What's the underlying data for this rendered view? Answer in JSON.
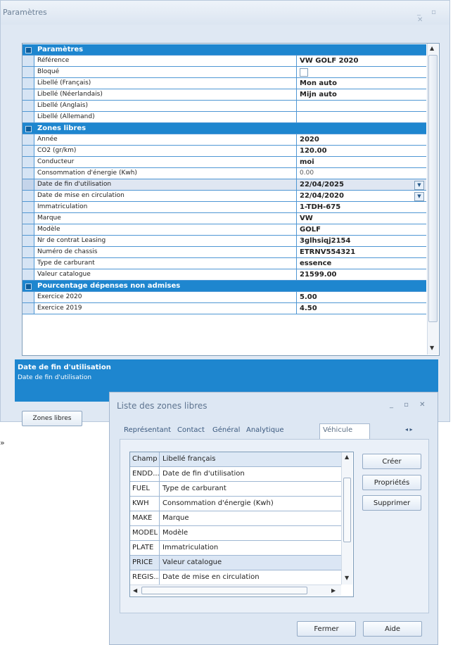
{
  "main_window": {
    "title": "Paramètres",
    "window_buttons": "_ ▫ ✕"
  },
  "grid": {
    "rows": [
      {
        "type": "header",
        "label": "Paramètres"
      },
      {
        "type": "row",
        "label": "Référence",
        "value": "VW GOLF 2020"
      },
      {
        "type": "checkbox",
        "label": "Bloqué",
        "value": ""
      },
      {
        "type": "row",
        "label": "Libellé (Français)",
        "value": "Mon auto"
      },
      {
        "type": "row",
        "label": "Libellé (Néerlandais)",
        "value": "Mijn auto"
      },
      {
        "type": "row",
        "label": "Libellé (Anglais)",
        "value": ""
      },
      {
        "type": "row",
        "label": "Libellé (Allemand)",
        "value": ""
      },
      {
        "type": "header",
        "label": "Zones libres"
      },
      {
        "type": "row",
        "label": "Année",
        "value": "2020"
      },
      {
        "type": "row",
        "label": "CO2 (gr/km)",
        "value": "120.00"
      },
      {
        "type": "row",
        "label": "Conducteur",
        "value": "moi"
      },
      {
        "type": "light",
        "label": "Consommation d'énergie (Kwh)",
        "value": "0.00"
      },
      {
        "type": "date",
        "label": "Date de fin d'utilisation",
        "value": "22/04/2025",
        "selected": true
      },
      {
        "type": "date",
        "label": "Date de mise en circulation",
        "value": "22/04/2020"
      },
      {
        "type": "row",
        "label": "Immatriculation",
        "value": "1-TDH-675"
      },
      {
        "type": "row",
        "label": "Marque",
        "value": "VW"
      },
      {
        "type": "row",
        "label": "Modèle",
        "value": "GOLF"
      },
      {
        "type": "row",
        "label": "Nr de contrat Leasing",
        "value": "3glhsiqj2154"
      },
      {
        "type": "row",
        "label": "Numéro de chassis",
        "value": "ETRNV554321"
      },
      {
        "type": "row",
        "label": "Type de carburant",
        "value": "essence"
      },
      {
        "type": "row",
        "label": "Valeur catalogue",
        "value": "21599.00"
      },
      {
        "type": "header",
        "label": "Pourcentage dépenses non admises"
      },
      {
        "type": "row",
        "label": "Exercice 2020",
        "value": "5.00"
      },
      {
        "type": "row",
        "label": "Exercice 2019",
        "value": "4.50"
      }
    ]
  },
  "description": {
    "title": "Date de fin d'utilisation",
    "text": "Date de fin d'utilisation"
  },
  "zones_button": "Zones libres",
  "edge_char": "»",
  "dialog": {
    "title": "Liste des zones libres",
    "window_buttons": "_ ▫ ✕",
    "tabs": [
      "Représentant",
      "Contact",
      "Général",
      "Analytique",
      "Véhicule"
    ],
    "active_tab": "Véhicule",
    "tab_nav": "◂ ▸",
    "columns": [
      "Champ",
      "Libellé français"
    ],
    "rows": [
      {
        "code": "ENDD...",
        "label": "Date de fin d'utilisation"
      },
      {
        "code": "FUEL",
        "label": "Type de carburant"
      },
      {
        "code": "KWH",
        "label": "Consommation d'énergie (Kwh)"
      },
      {
        "code": "MAKE",
        "label": "Marque"
      },
      {
        "code": "MODEL",
        "label": "Modèle"
      },
      {
        "code": "PLATE",
        "label": "Immatriculation"
      },
      {
        "code": "PRICE",
        "label": "Valeur catalogue",
        "selected": true
      },
      {
        "code": "REGIS...",
        "label": "Date de mise en circulation"
      }
    ],
    "buttons": {
      "create": "Créer",
      "properties": "Propriétés",
      "delete": "Supprimer",
      "close": "Fermer",
      "help": "Aide"
    }
  }
}
